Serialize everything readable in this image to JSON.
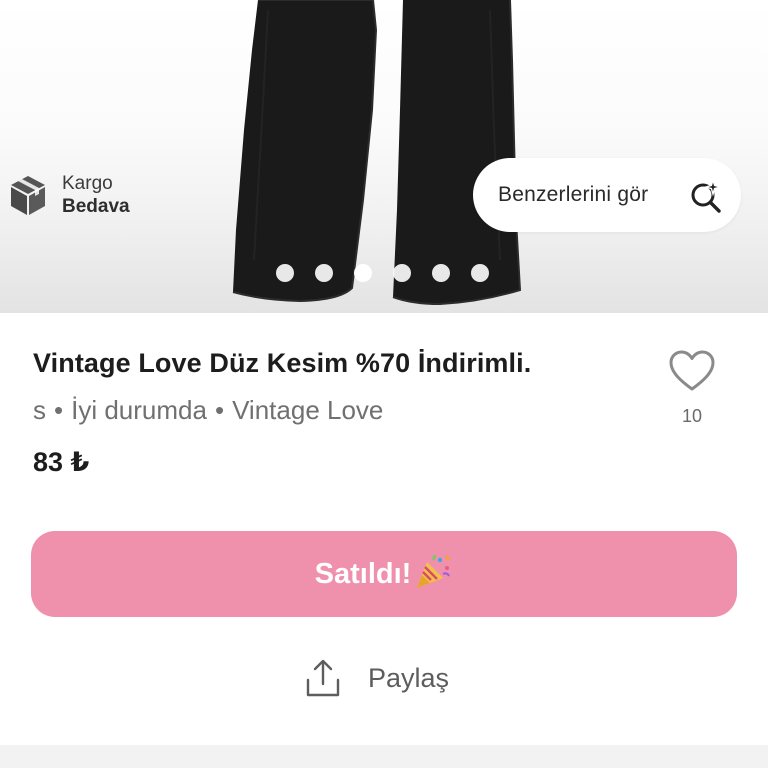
{
  "gallery": {
    "shipping_line1": "Kargo",
    "shipping_line2": "Bedava",
    "similar_button_label": "Benzerlerini gör",
    "icons": {
      "shipping": "box-icon",
      "similar": "search-sparkle-icon"
    },
    "dot_count": 6,
    "active_dot": 3
  },
  "product": {
    "title": "Vintage Love Düz Kesim %70 İndirimli.",
    "size": "s",
    "condition": "İyi durumda",
    "brand": "Vintage Love",
    "separator": "•",
    "price": "83 ₺",
    "like_count": "10"
  },
  "actions": {
    "sold_label": "Satıldı!",
    "share_label": "Paylaş",
    "icons": {
      "sold": "party-popper-icon",
      "share": "share-icon",
      "like": "heart-icon"
    }
  },
  "colors": {
    "sold_button": "#ef90ad",
    "title_text": "#1d1d1d",
    "meta_text": "#707070"
  }
}
